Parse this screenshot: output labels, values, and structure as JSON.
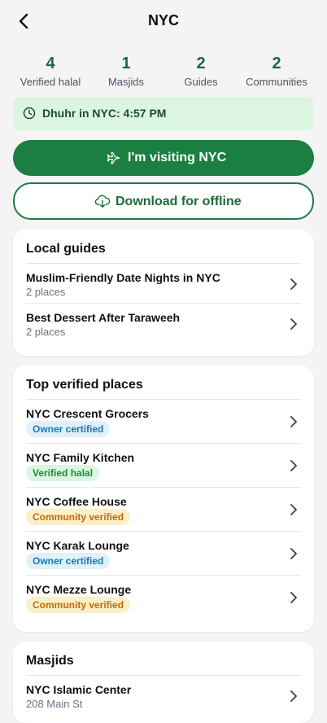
{
  "header": {
    "title": "NYC"
  },
  "stats": [
    {
      "value": "4",
      "label": "Verified halal"
    },
    {
      "value": "1",
      "label": "Masjids"
    },
    {
      "value": "2",
      "label": "Guides"
    },
    {
      "value": "2",
      "label": "Communities"
    }
  ],
  "prayer": {
    "text": "Dhuhr in NYC: 4:57 PM"
  },
  "actions": {
    "visiting_label": "I'm visiting NYC",
    "download_label": "Download for offline"
  },
  "guides": {
    "title": "Local guides",
    "items": [
      {
        "name": "Muslim-Friendly Date Nights in NYC",
        "meta": "2 places"
      },
      {
        "name": "Best Dessert After Taraweeh",
        "meta": "2 places"
      }
    ]
  },
  "places": {
    "title": "Top verified places",
    "items": [
      {
        "name": "NYC Crescent Grocers",
        "badge": "Owner certified",
        "badge_type": "owner"
      },
      {
        "name": "NYC Family Kitchen",
        "badge": "Verified halal",
        "badge_type": "verified"
      },
      {
        "name": "NYC Coffee House",
        "badge": "Community verified",
        "badge_type": "community"
      },
      {
        "name": "NYC Karak Lounge",
        "badge": "Owner certified",
        "badge_type": "owner"
      },
      {
        "name": "NYC Mezze Lounge",
        "badge": "Community verified",
        "badge_type": "community"
      }
    ]
  },
  "masjids": {
    "title": "Masjids",
    "items": [
      {
        "name": "NYC Islamic Center",
        "address": "208 Main St"
      }
    ]
  },
  "colors": {
    "primary": "#1a7f40",
    "owner_badge": "#1778b0",
    "verified_badge": "#1b8a44",
    "community_badge": "#c06a0a"
  }
}
